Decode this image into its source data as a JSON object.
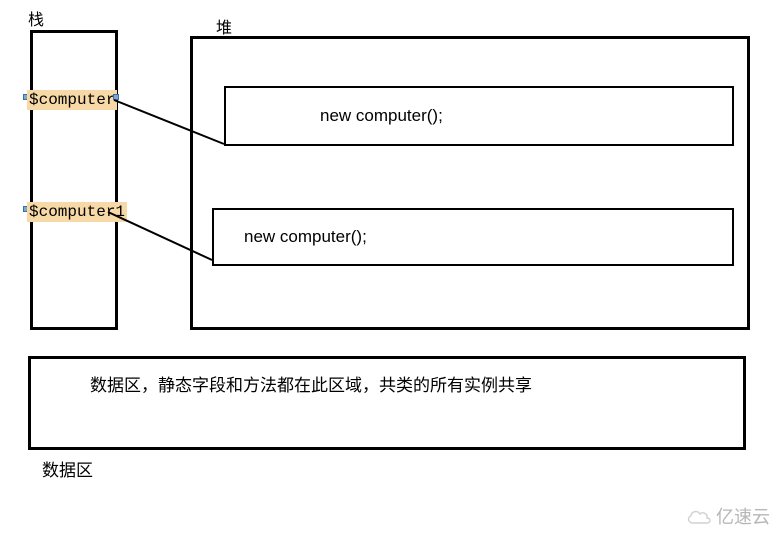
{
  "labels": {
    "stack": "栈",
    "heap": "堆",
    "dataArea": "数据区"
  },
  "stackVars": {
    "v1": "$computer",
    "v2": "$computer1"
  },
  "heapObjects": {
    "o1": "new computer();",
    "o2": "new computer();"
  },
  "dataAreaDescription": "数据区，静态字段和方法都在此区域，共类的所有实例共享",
  "watermark": "亿速云"
}
